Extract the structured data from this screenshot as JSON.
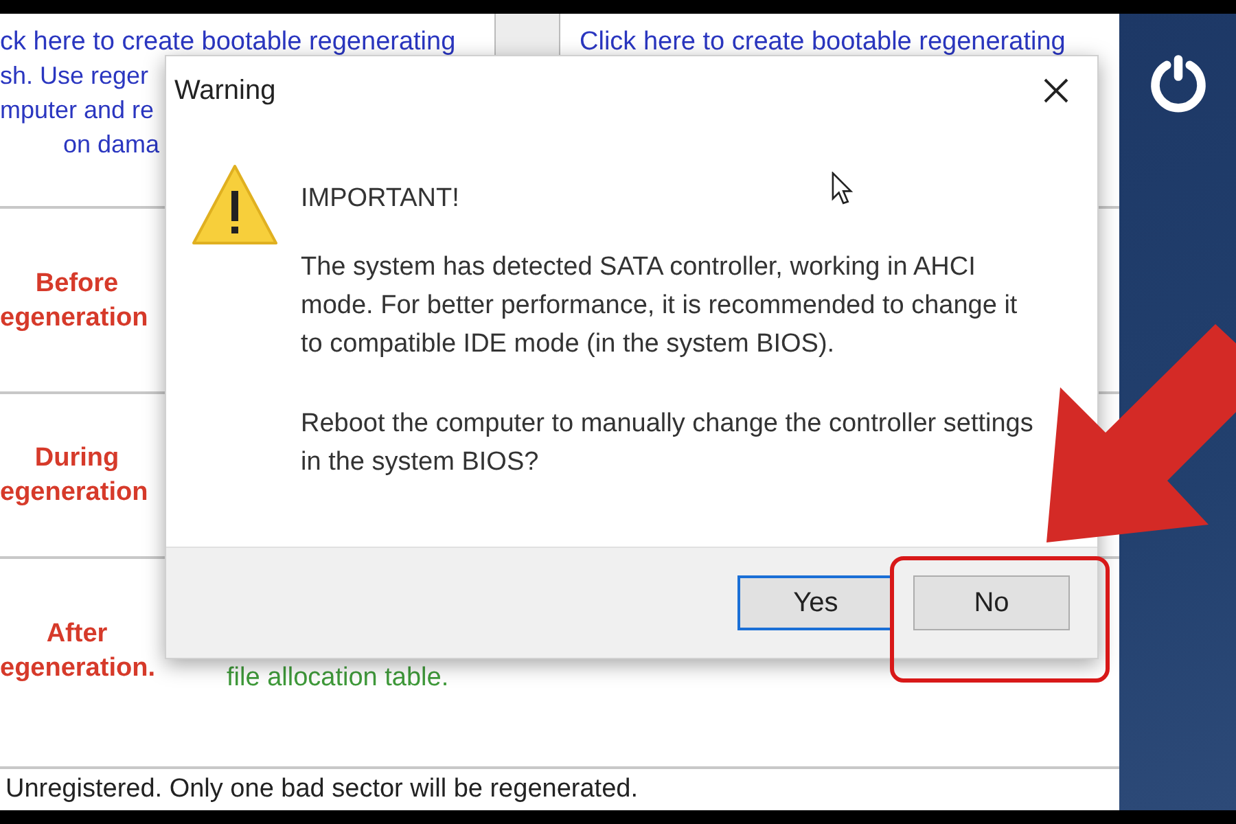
{
  "app_window": {
    "top_links": [
      {
        "lines": [
          "ck here to create bootable regenerating",
          "sh. Use reger",
          "mputer and re",
          "on dama"
        ]
      },
      {
        "lines": [
          "Click here to create bootable regenerating"
        ]
      }
    ],
    "rows": [
      {
        "label_lines": [
          "Before",
          "egeneration"
        ]
      },
      {
        "label_lines": [
          "During",
          "egeneration"
        ]
      },
      {
        "label_lines": [
          "After",
          "egeneration."
        ],
        "detail": "file allocation table."
      }
    ],
    "status_bar": "Unregistered. Only one bad sector will be regenerated."
  },
  "dialog": {
    "title": "Warning",
    "heading": "IMPORTANT!",
    "paragraphs": [
      "The system has detected SATA controller, working in AHCI mode. For better performance, it is recommended to change it to compatible IDE mode (in the system BIOS).",
      "Reboot the computer to manually change the controller settings in the system BIOS?"
    ],
    "buttons": [
      {
        "label": "Yes",
        "focused": true
      },
      {
        "label": "No",
        "focused": false
      }
    ]
  }
}
